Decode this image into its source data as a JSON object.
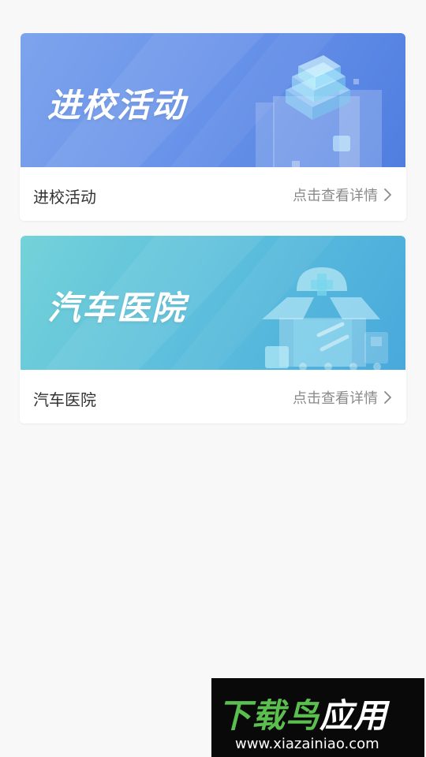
{
  "cards": [
    {
      "banner_title": "进校活动",
      "title": "进校活动",
      "detail_label": "点击查看详情"
    },
    {
      "banner_title": "汽车医院",
      "title": "汽车医院",
      "detail_label": "点击查看详情"
    }
  ],
  "watermark": {
    "brand_main": "下载鸟",
    "brand_tail": "应用",
    "url": "www.xiazainiao.com"
  },
  "icons": {
    "detail_arrow": "chevron-right-icon"
  },
  "colors": {
    "card1_banner": "#6a94ea",
    "card2_banner": "#5ec0dc",
    "background": "#f8f8f8",
    "watermark_green": "#5bbf4f"
  }
}
